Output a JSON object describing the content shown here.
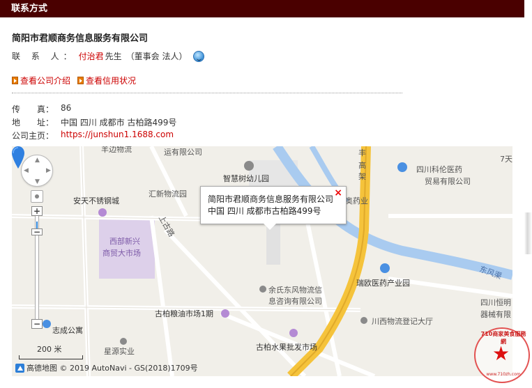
{
  "header": {
    "title": "联系方式"
  },
  "company": {
    "name": "简阳市君顺商务信息服务有限公司"
  },
  "contact": {
    "label": "联 系 人：",
    "person": "付治君",
    "title": "先生",
    "role": "（董事会 法人）",
    "im_icon": "chat-avatar-icon"
  },
  "links": [
    {
      "label": "查看公司介绍",
      "icon": "arrow-box-icon"
    },
    {
      "label": "查看信用状况",
      "icon": "arrow-box-icon"
    }
  ],
  "info": {
    "fax_label": "传　　真：",
    "fax_value": "86",
    "address_label": "地　　址：",
    "address_value": "中国 四川 成都市 古柏路499号",
    "homepage_label": "公司主页：",
    "homepage_value": "https://junshun1.1688.com"
  },
  "map": {
    "popup_line1": "简阳市君顺商务信息服务有限公司",
    "popup_line2": "中国 四川 成都市古柏路499号",
    "popup_close": "×",
    "scale_label": "200 米",
    "attribution": "高德地图 © 2019 AutoNavi - GS(2018)1709号",
    "labels": {
      "l1": "羊边物流",
      "l2": "运有限公司",
      "l3": "智慧树幼儿园",
      "l4": "丰",
      "l5": "高",
      "l6": "架",
      "l7": "四川科伦医药",
      "l8": "贸易有限公司",
      "l9": "7天",
      "l10": "汇新物流园",
      "l11": "安天不锈钢城",
      "l12": "奥药业",
      "l13": "上古路",
      "l14": "西部新兴",
      "l15": "商贸大市场",
      "l16": "瑞欧医药产业园",
      "l17": "东风渠",
      "l18": "余氏东风物流信",
      "l19": "息咨询有限公司",
      "l20": "四川恒明",
      "l21": "器械有限",
      "l22": "古柏粮油市场1期",
      "l23": "川西物流登记大厅",
      "l24": "志成公寓",
      "l25": "古柏水果批发市场",
      "l26": "星源实业"
    }
  },
  "watermark": {
    "text": "710商家美食服務網",
    "url": "www.710zh.com"
  },
  "colors": {
    "header_bg": "#4a0000",
    "accent_red": "#cc0000",
    "water": "#a9cbf0",
    "highway": "#f5c33b"
  }
}
